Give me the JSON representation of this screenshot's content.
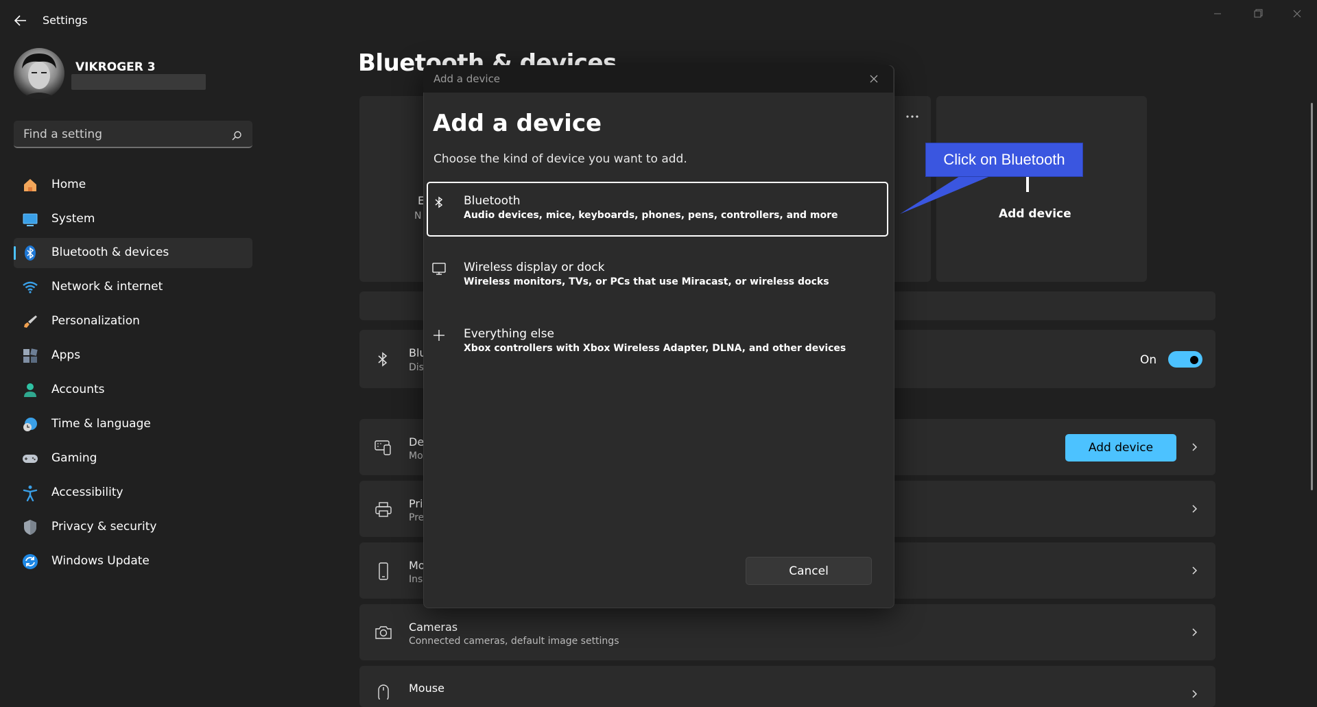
{
  "app": {
    "title": "Settings"
  },
  "profile": {
    "name": "VIKROGER 3"
  },
  "search": {
    "placeholder": "Find a setting"
  },
  "nav": {
    "items": [
      {
        "label": "Home",
        "icon": "home-icon"
      },
      {
        "label": "System",
        "icon": "system-icon"
      },
      {
        "label": "Bluetooth & devices",
        "icon": "bluetooth-icon",
        "active": true
      },
      {
        "label": "Network & internet",
        "icon": "wifi-icon"
      },
      {
        "label": "Personalization",
        "icon": "brush-icon"
      },
      {
        "label": "Apps",
        "icon": "apps-icon"
      },
      {
        "label": "Accounts",
        "icon": "accounts-icon"
      },
      {
        "label": "Time & language",
        "icon": "clock-globe-icon"
      },
      {
        "label": "Gaming",
        "icon": "gamepad-icon"
      },
      {
        "label": "Accessibility",
        "icon": "accessibility-icon"
      },
      {
        "label": "Privacy & security",
        "icon": "shield-icon"
      },
      {
        "label": "Windows Update",
        "icon": "update-icon"
      }
    ]
  },
  "main": {
    "title": "Bluetooth & devices",
    "add_device_tile": "Add device",
    "tile_partial_title": "E",
    "tile_partial_sub": "N",
    "bluetooth_row": {
      "title": "Blu",
      "sub": "Dis",
      "state": "On"
    },
    "rows": [
      {
        "title": "De",
        "sub": "Mo",
        "icon": "devices-icon",
        "button": "Add device"
      },
      {
        "title": "Pri",
        "sub": "Pre",
        "icon": "printer-icon"
      },
      {
        "title": "Mo",
        "sub": "Ins",
        "icon": "phone-icon"
      },
      {
        "title": "Cameras",
        "sub": "Connected cameras, default image settings",
        "icon": "camera-icon"
      },
      {
        "title": "Mouse",
        "sub": "",
        "icon": "mouse-icon"
      }
    ]
  },
  "dialog": {
    "caption": "Add a device",
    "heading": "Add a device",
    "description": "Choose the kind of device you want to add.",
    "options": [
      {
        "title": "Bluetooth",
        "desc": "Audio devices, mice, keyboards, phones, pens, controllers, and more",
        "icon": "bluetooth-icon",
        "selected": true
      },
      {
        "title": "Wireless display or dock",
        "desc": "Wireless monitors, TVs, or PCs that use Miracast, or wireless docks",
        "icon": "monitor-icon"
      },
      {
        "title": "Everything else",
        "desc": "Xbox controllers with Xbox Wireless Adapter, DLNA, and other devices",
        "icon": "plus-icon"
      }
    ],
    "cancel": "Cancel"
  },
  "callout": {
    "text": "Click on Bluetooth",
    "color": "#3a56e0"
  },
  "colors": {
    "accent": "#4cc2ff",
    "background": "#202020",
    "card": "#2b2b2b"
  }
}
